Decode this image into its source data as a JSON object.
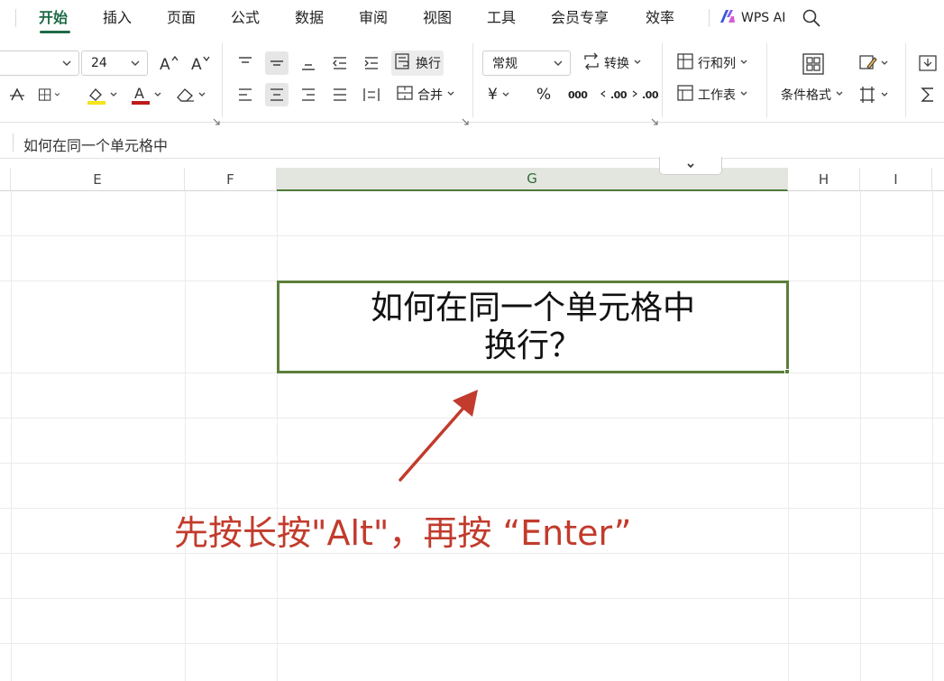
{
  "menu": {
    "tabs": [
      {
        "label": "开始",
        "active": true
      },
      {
        "label": "插入"
      },
      {
        "label": "页面"
      },
      {
        "label": "公式"
      },
      {
        "label": "数据"
      },
      {
        "label": "审阅"
      },
      {
        "label": "视图"
      },
      {
        "label": "工具"
      },
      {
        "label": "会员专享"
      },
      {
        "label": "效率"
      }
    ],
    "ai_label": "WPS AI"
  },
  "ribbon": {
    "font_size": "24",
    "wrap_label": "换行",
    "merge_label": "合并",
    "number_format": "常规",
    "convert_label": "转换",
    "rows_cols_label": "行和列",
    "worksheet_label": "工作表",
    "cond_format_label": "条件格式",
    "currency_symbol": "¥",
    "percent_symbol": "%",
    "thousands_label": "000",
    "dec_inc_label": ".00",
    "dec_dec_label": ".00"
  },
  "formula_bar": {
    "content": "如何在同一个单元格中"
  },
  "grid": {
    "columns": [
      "E",
      "F",
      "G",
      "H",
      "I"
    ],
    "selected_column": "G",
    "active_cell_lines": [
      "如何在同一个单元格中",
      "换行？"
    ]
  },
  "annotation": {
    "text": "先按长按\"Alt\"，再按 “Enter”",
    "color": "#c23b2c"
  },
  "colors": {
    "accent": "#1f6b45",
    "cell_border": "#5b7f3a",
    "highlight_yellow": "#f5e41a",
    "font_red": "#c0191c"
  }
}
